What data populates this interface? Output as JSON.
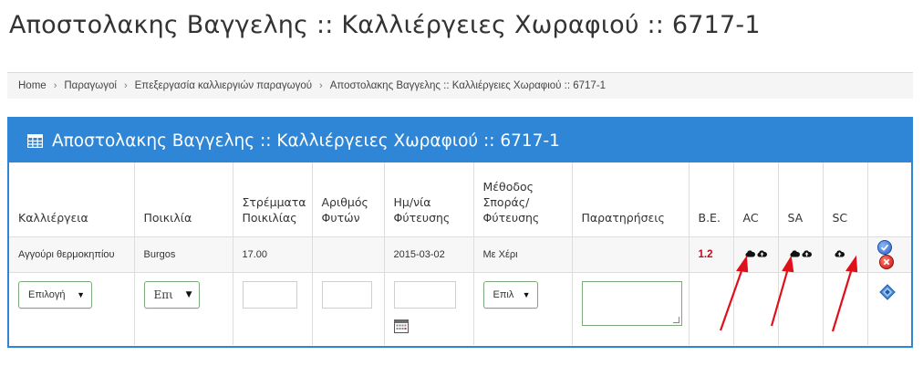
{
  "page": {
    "title": "Αποστολακης Βαγγελης :: Καλλιέργειες Χωραφιού :: 6717-1"
  },
  "breadcrumb": {
    "items": [
      "Home",
      "Παραγωγοί",
      "Επεξεργασία καλλιεργιών παραγωγού",
      "Αποστολακης Βαγγελης :: Καλλιέργειες Χωραφιού :: 6717-1"
    ],
    "separator": "›"
  },
  "panel": {
    "heading": "Αποστολακης Βαγγελης :: Καλλιέργειες Χωραφιού :: 6717-1",
    "heading_icon": "table-grid-icon"
  },
  "table": {
    "headers": {
      "crop": "Καλλιέργεια",
      "variety": "Ποικιλία",
      "area_l1": "Στρέμματα",
      "area_l2": "Ποικιλίας",
      "plants_l1": "Αριθμός",
      "plants_l2": "Φυτών",
      "date_l1": "Ημ/νία",
      "date_l2": "Φύτευσης",
      "method_l1": "Μέθοδος",
      "method_l2": "Σποράς/",
      "method_l3": "Φύτευσης",
      "notes": "Παρατηρήσεις",
      "be": "Β.Ε.",
      "ac": "AC",
      "sa": "SA",
      "sc": "SC"
    },
    "row": {
      "crop": "Αγγούρι θερμοκηπίου",
      "variety": "Burgos",
      "area": "17.00",
      "plants": "",
      "date": "2015-03-02",
      "method": "Με Χέρι",
      "notes": "",
      "be": "1.2",
      "ac_icons": [
        "cloud-icon",
        "cloud-upload-icon"
      ],
      "sa_icons": [
        "cloud-icon",
        "cloud-upload-icon"
      ],
      "sc_icons": [
        "cloud-upload-icon"
      ]
    },
    "input_row": {
      "crop_select": "Επιλογή",
      "variety_select": "Επι",
      "method_select": "Επιλ"
    }
  },
  "colors": {
    "primary": "#2f86d6",
    "be_value": "#d0021b",
    "annotation_arrow": "#e0101a"
  }
}
